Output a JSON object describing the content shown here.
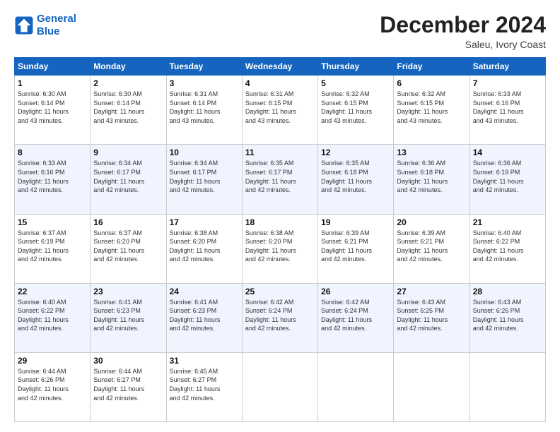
{
  "logo": {
    "line1": "General",
    "line2": "Blue"
  },
  "header": {
    "month": "December 2024",
    "location": "Saleu, Ivory Coast"
  },
  "weekdays": [
    "Sunday",
    "Monday",
    "Tuesday",
    "Wednesday",
    "Thursday",
    "Friday",
    "Saturday"
  ],
  "weeks": [
    [
      {
        "day": "1",
        "lines": [
          "Sunrise: 6:30 AM",
          "Sunset: 6:14 PM",
          "Daylight: 11 hours",
          "and 43 minutes."
        ]
      },
      {
        "day": "2",
        "lines": [
          "Sunrise: 6:30 AM",
          "Sunset: 6:14 PM",
          "Daylight: 11 hours",
          "and 43 minutes."
        ]
      },
      {
        "day": "3",
        "lines": [
          "Sunrise: 6:31 AM",
          "Sunset: 6:14 PM",
          "Daylight: 11 hours",
          "and 43 minutes."
        ]
      },
      {
        "day": "4",
        "lines": [
          "Sunrise: 6:31 AM",
          "Sunset: 6:15 PM",
          "Daylight: 11 hours",
          "and 43 minutes."
        ]
      },
      {
        "day": "5",
        "lines": [
          "Sunrise: 6:32 AM",
          "Sunset: 6:15 PM",
          "Daylight: 11 hours",
          "and 43 minutes."
        ]
      },
      {
        "day": "6",
        "lines": [
          "Sunrise: 6:32 AM",
          "Sunset: 6:15 PM",
          "Daylight: 11 hours",
          "and 43 minutes."
        ]
      },
      {
        "day": "7",
        "lines": [
          "Sunrise: 6:33 AM",
          "Sunset: 6:16 PM",
          "Daylight: 11 hours",
          "and 43 minutes."
        ]
      }
    ],
    [
      {
        "day": "8",
        "lines": [
          "Sunrise: 6:33 AM",
          "Sunset: 6:16 PM",
          "Daylight: 11 hours",
          "and 42 minutes."
        ]
      },
      {
        "day": "9",
        "lines": [
          "Sunrise: 6:34 AM",
          "Sunset: 6:17 PM",
          "Daylight: 11 hours",
          "and 42 minutes."
        ]
      },
      {
        "day": "10",
        "lines": [
          "Sunrise: 6:34 AM",
          "Sunset: 6:17 PM",
          "Daylight: 11 hours",
          "and 42 minutes."
        ]
      },
      {
        "day": "11",
        "lines": [
          "Sunrise: 6:35 AM",
          "Sunset: 6:17 PM",
          "Daylight: 11 hours",
          "and 42 minutes."
        ]
      },
      {
        "day": "12",
        "lines": [
          "Sunrise: 6:35 AM",
          "Sunset: 6:18 PM",
          "Daylight: 11 hours",
          "and 42 minutes."
        ]
      },
      {
        "day": "13",
        "lines": [
          "Sunrise: 6:36 AM",
          "Sunset: 6:18 PM",
          "Daylight: 11 hours",
          "and 42 minutes."
        ]
      },
      {
        "day": "14",
        "lines": [
          "Sunrise: 6:36 AM",
          "Sunset: 6:19 PM",
          "Daylight: 11 hours",
          "and 42 minutes."
        ]
      }
    ],
    [
      {
        "day": "15",
        "lines": [
          "Sunrise: 6:37 AM",
          "Sunset: 6:19 PM",
          "Daylight: 11 hours",
          "and 42 minutes."
        ]
      },
      {
        "day": "16",
        "lines": [
          "Sunrise: 6:37 AM",
          "Sunset: 6:20 PM",
          "Daylight: 11 hours",
          "and 42 minutes."
        ]
      },
      {
        "day": "17",
        "lines": [
          "Sunrise: 6:38 AM",
          "Sunset: 6:20 PM",
          "Daylight: 11 hours",
          "and 42 minutes."
        ]
      },
      {
        "day": "18",
        "lines": [
          "Sunrise: 6:38 AM",
          "Sunset: 6:20 PM",
          "Daylight: 11 hours",
          "and 42 minutes."
        ]
      },
      {
        "day": "19",
        "lines": [
          "Sunrise: 6:39 AM",
          "Sunset: 6:21 PM",
          "Daylight: 11 hours",
          "and 42 minutes."
        ]
      },
      {
        "day": "20",
        "lines": [
          "Sunrise: 6:39 AM",
          "Sunset: 6:21 PM",
          "Daylight: 11 hours",
          "and 42 minutes."
        ]
      },
      {
        "day": "21",
        "lines": [
          "Sunrise: 6:40 AM",
          "Sunset: 6:22 PM",
          "Daylight: 11 hours",
          "and 42 minutes."
        ]
      }
    ],
    [
      {
        "day": "22",
        "lines": [
          "Sunrise: 6:40 AM",
          "Sunset: 6:22 PM",
          "Daylight: 11 hours",
          "and 42 minutes."
        ]
      },
      {
        "day": "23",
        "lines": [
          "Sunrise: 6:41 AM",
          "Sunset: 6:23 PM",
          "Daylight: 11 hours",
          "and 42 minutes."
        ]
      },
      {
        "day": "24",
        "lines": [
          "Sunrise: 6:41 AM",
          "Sunset: 6:23 PM",
          "Daylight: 11 hours",
          "and 42 minutes."
        ]
      },
      {
        "day": "25",
        "lines": [
          "Sunrise: 6:42 AM",
          "Sunset: 6:24 PM",
          "Daylight: 11 hours",
          "and 42 minutes."
        ]
      },
      {
        "day": "26",
        "lines": [
          "Sunrise: 6:42 AM",
          "Sunset: 6:24 PM",
          "Daylight: 11 hours",
          "and 42 minutes."
        ]
      },
      {
        "day": "27",
        "lines": [
          "Sunrise: 6:43 AM",
          "Sunset: 6:25 PM",
          "Daylight: 11 hours",
          "and 42 minutes."
        ]
      },
      {
        "day": "28",
        "lines": [
          "Sunrise: 6:43 AM",
          "Sunset: 6:26 PM",
          "Daylight: 11 hours",
          "and 42 minutes."
        ]
      }
    ],
    [
      {
        "day": "29",
        "lines": [
          "Sunrise: 6:44 AM",
          "Sunset: 6:26 PM",
          "Daylight: 11 hours",
          "and 42 minutes."
        ]
      },
      {
        "day": "30",
        "lines": [
          "Sunrise: 6:44 AM",
          "Sunset: 6:27 PM",
          "Daylight: 11 hours",
          "and 42 minutes."
        ]
      },
      {
        "day": "31",
        "lines": [
          "Sunrise: 6:45 AM",
          "Sunset: 6:27 PM",
          "Daylight: 11 hours",
          "and 42 minutes."
        ]
      },
      null,
      null,
      null,
      null
    ]
  ]
}
